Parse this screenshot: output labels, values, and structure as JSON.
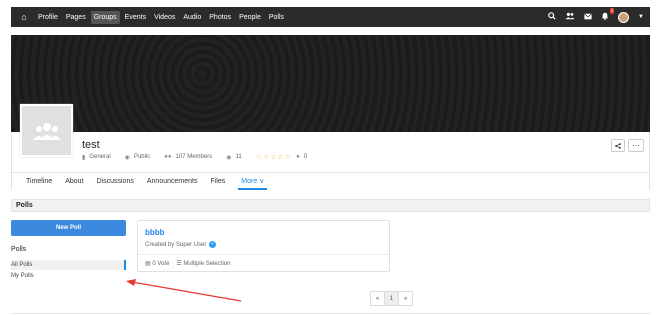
{
  "navbar": {
    "items": [
      {
        "label": "Profile",
        "active": false
      },
      {
        "label": "Pages",
        "active": false
      },
      {
        "label": "Groups",
        "active": true
      },
      {
        "label": "Events",
        "active": false
      },
      {
        "label": "Videos",
        "active": false
      },
      {
        "label": "Audio",
        "active": false
      },
      {
        "label": "Photos",
        "active": false
      },
      {
        "label": "People",
        "active": false
      },
      {
        "label": "Polls",
        "active": false
      }
    ],
    "notification_count": "3"
  },
  "group": {
    "title": "test",
    "category": "General",
    "privacy": "Public",
    "members": "107 Members",
    "views": "11",
    "rating_count": "0"
  },
  "tabs": [
    {
      "label": "Timeline"
    },
    {
      "label": "About"
    },
    {
      "label": "Discussions"
    },
    {
      "label": "Announcements"
    },
    {
      "label": "Files"
    },
    {
      "label": "More",
      "active": true
    }
  ],
  "section": {
    "title": "Polls"
  },
  "sidebar": {
    "new_poll_label": "New Poll",
    "title": "Polls",
    "items": [
      {
        "label": "All Polls",
        "active": true
      },
      {
        "label": "My Polls",
        "active": false
      }
    ]
  },
  "poll": {
    "title": "bbbb",
    "author": "Created by Super User",
    "votes": "0 Vote",
    "type": "Multiple Selection"
  },
  "pagination": {
    "prev": "«",
    "current": "1",
    "next": "»"
  },
  "colors": {
    "accent": "#1e88e5",
    "navbar_bg": "#2b2b2b",
    "button_bg": "#3b8ae0",
    "annotation_arrow": "#e53935"
  }
}
